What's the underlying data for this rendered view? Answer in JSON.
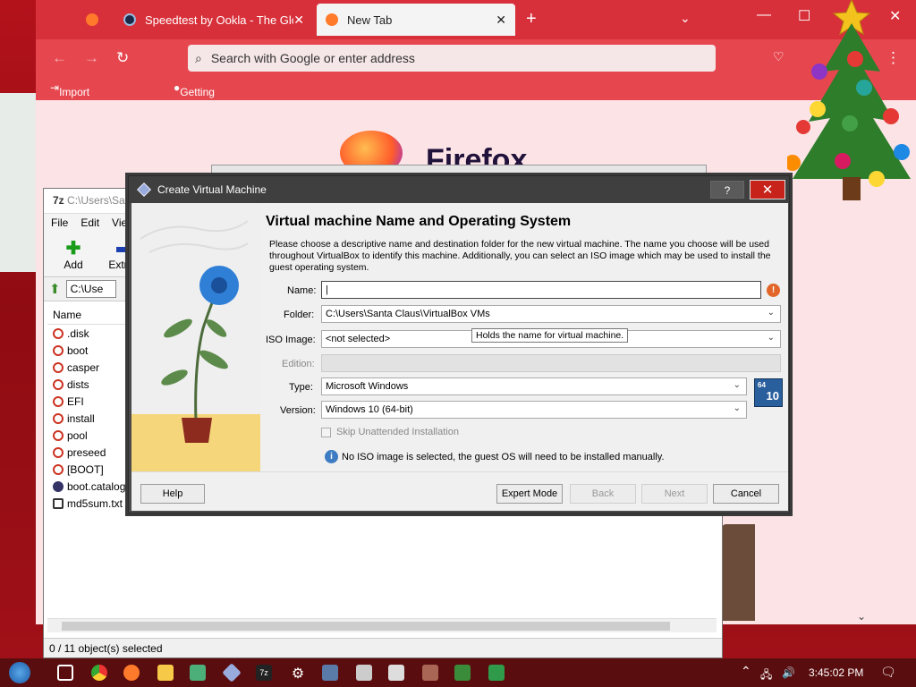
{
  "firefox": {
    "tabs": [
      {
        "label": ""
      },
      {
        "label": "Speedtest by Ookla - The Global"
      },
      {
        "label": "New Tab"
      }
    ],
    "address_placeholder": "Search with Google or enter address",
    "bookmarks": [
      "Import bookmarks...",
      "Getting Started"
    ],
    "brand": "Firefox"
  },
  "zip": {
    "title": "C:\\Users\\Sa",
    "menu": [
      "File",
      "Edit",
      "Vie"
    ],
    "tools": [
      {
        "label": "Add",
        "icon": "plus-icon"
      },
      {
        "label": "Extract",
        "icon": "minus-icon"
      }
    ],
    "path": "C:\\Use",
    "column_name": "Name",
    "files": [
      ".disk",
      "boot",
      "casper",
      "dists",
      "EFI",
      "install",
      "pool",
      "preseed",
      "[BOOT]",
      "boot.catalog",
      "md5sum.txt"
    ],
    "status": "0 / 11 object(s) selected"
  },
  "vbox": {
    "title": "Create Virtual Machine",
    "help_btn": "?",
    "heading": "Virtual machine Name and Operating System",
    "description": "Please choose a descriptive name and destination folder for the new virtual machine. The name you choose will be used throughout VirtualBox to identify this machine. Additionally, you can select an ISO image which may be used to install the guest operating system.",
    "fields": {
      "name": {
        "label": "Name:",
        "value": ""
      },
      "folder": {
        "label": "Folder:",
        "value": "C:\\Users\\Santa Claus\\VirtualBox VMs"
      },
      "iso": {
        "label": "ISO Image:",
        "value": "<not selected>"
      },
      "edition": {
        "label": "Edition:",
        "value": ""
      },
      "type": {
        "label": "Type:",
        "value": "Microsoft Windows"
      },
      "version": {
        "label": "Version:",
        "value": "Windows 10 (64-bit)"
      }
    },
    "tooltip": "Holds the name for virtual machine.",
    "os_badge": "64",
    "os_badge_num": "10",
    "skip_unattended": "Skip Unattended Installation",
    "info_text": "No ISO image is selected, the guest OS will need to be installed manually.",
    "buttons": {
      "help": "Help",
      "expert": "Expert Mode",
      "back": "Back",
      "next": "Next",
      "cancel": "Cancel"
    }
  },
  "taskbar": {
    "time": "3:45:02 PM"
  },
  "colors": {
    "ff_red": "#d8303a",
    "vbox_close": "#c8231a",
    "taskbar": "#5a0d0e"
  }
}
